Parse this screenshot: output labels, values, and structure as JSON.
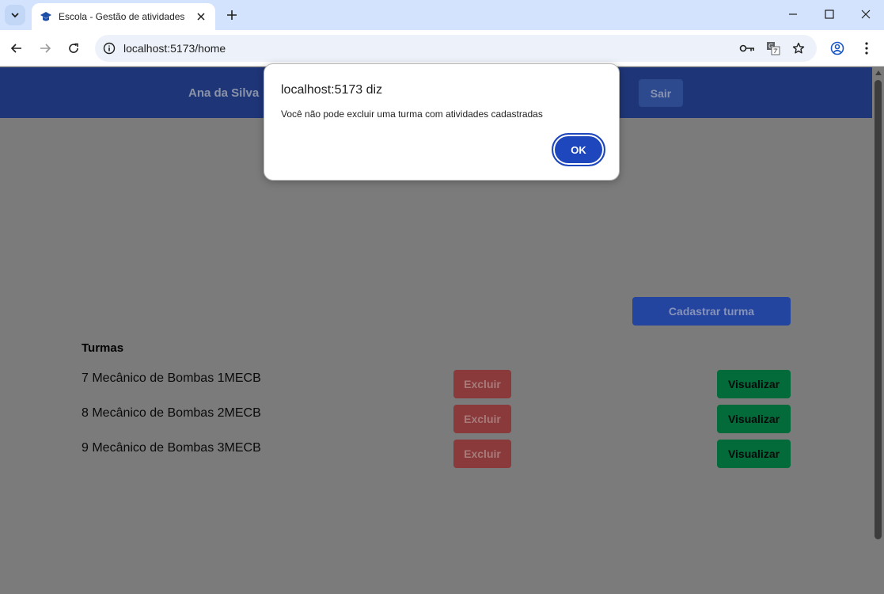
{
  "browser": {
    "tab_title": "Escola - Gestão de atividades",
    "url": "localhost:5173/home"
  },
  "app": {
    "user_name": "Ana da Silva",
    "logout_label": "Sair",
    "register_label": "Cadastrar turma",
    "section_title": "Turmas",
    "classes": [
      {
        "name": "7 Mecânico de Bombas 1MECB",
        "delete_label": "Excluir",
        "view_label": "Visualizar"
      },
      {
        "name": "8 Mecânico de Bombas 2MECB",
        "delete_label": "Excluir",
        "view_label": "Visualizar"
      },
      {
        "name": "9 Mecânico de Bombas 3MECB",
        "delete_label": "Excluir",
        "view_label": "Visualizar"
      }
    ]
  },
  "dialog": {
    "title": "localhost:5173 diz",
    "message": "Você não pode excluir uma turma com atividades cadastradas",
    "ok_label": "OK"
  },
  "colors": {
    "header": "#1e3577",
    "accent": "#1f47bd",
    "delete": "#8a3a3a",
    "view": "#036a3a"
  }
}
